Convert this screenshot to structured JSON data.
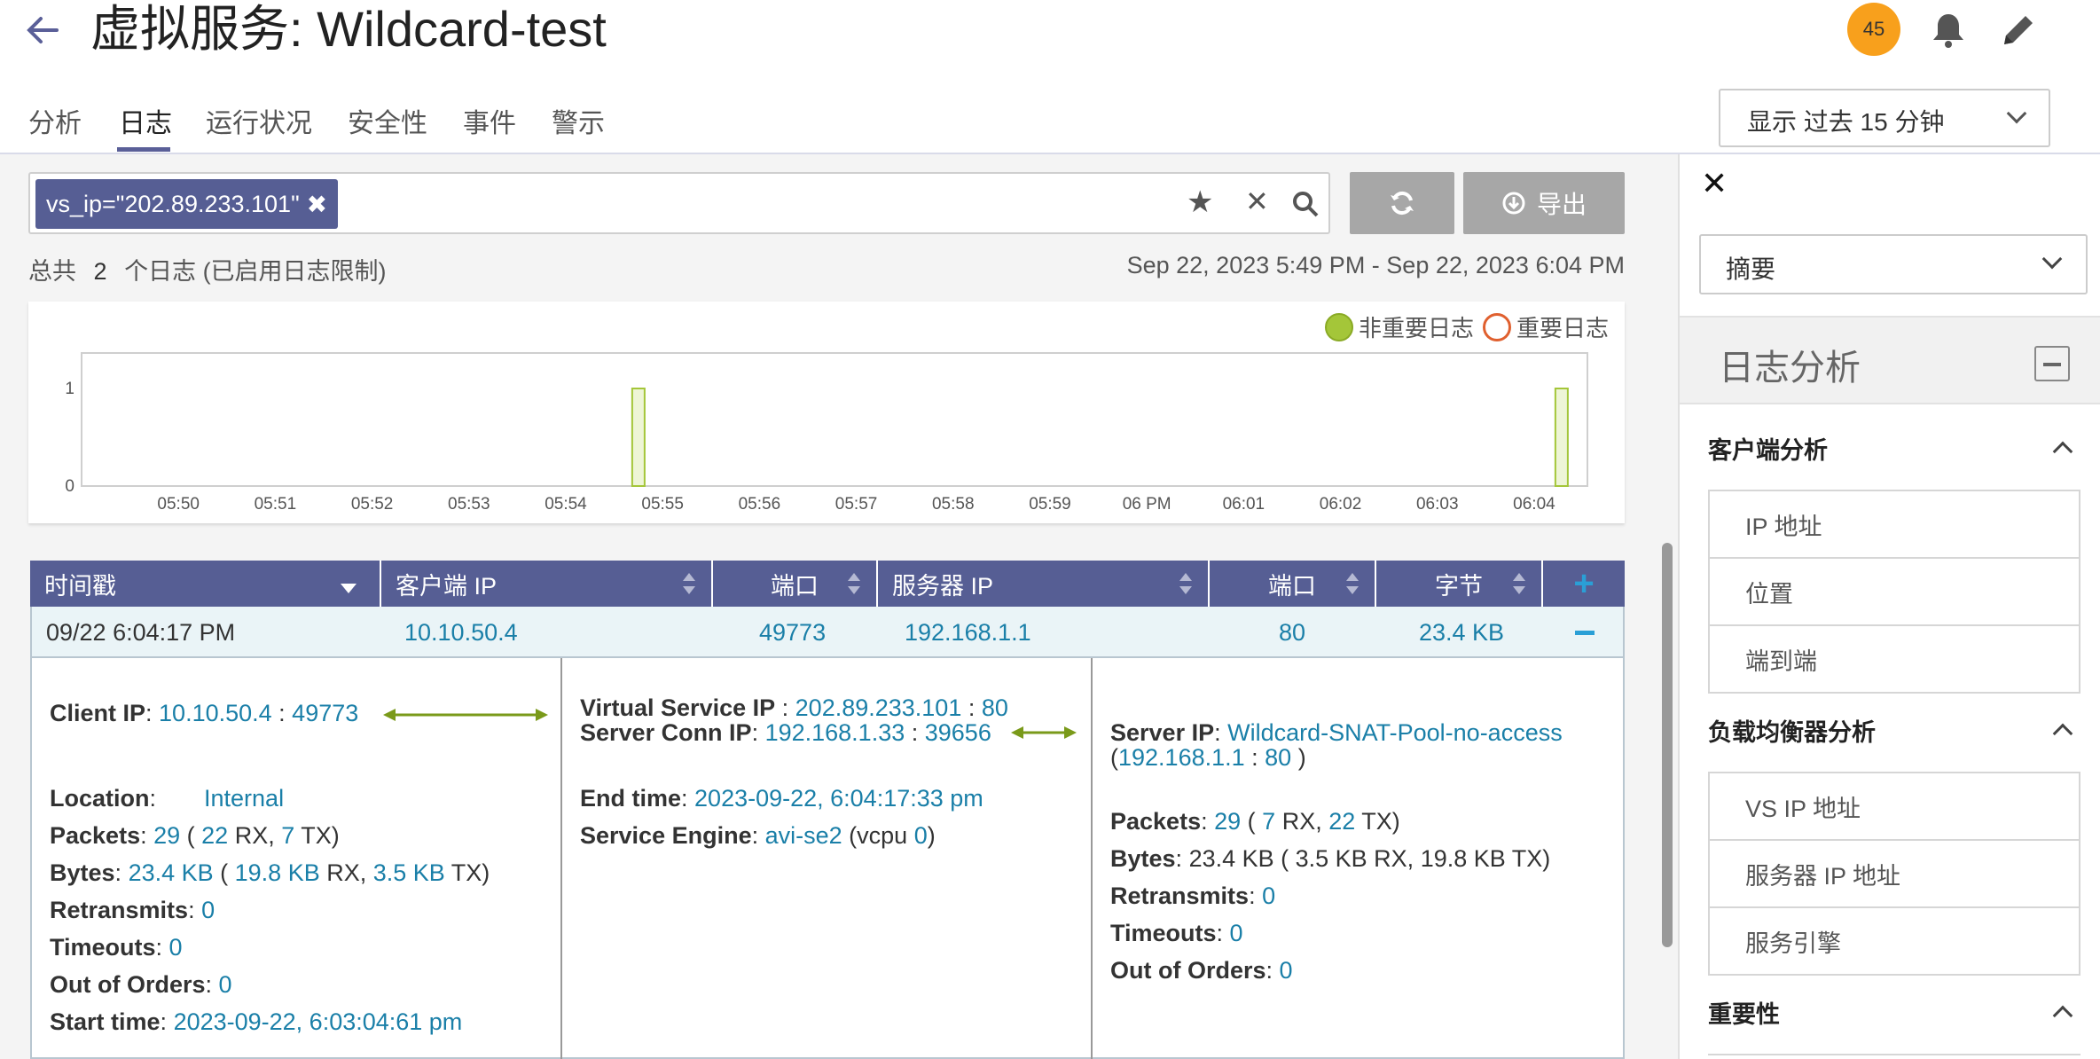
{
  "header": {
    "title": "虚拟服务: Wildcard-test",
    "badge_count": "45"
  },
  "tabs": [
    "分析",
    "日志",
    "运行状况",
    "安全性",
    "事件",
    "警示"
  ],
  "active_tab": "日志",
  "time_range": "显示 过去 15 分钟",
  "search": {
    "chip": "vs_ip=\"202.89.233.101\"",
    "export_label": "导出"
  },
  "summary": {
    "prefix": "总共",
    "count": "2",
    "suffix": "个日志 (已启用日志限制)",
    "range": "Sep 22, 2023 5:49 PM - Sep 22, 2023 6:04 PM"
  },
  "chart_data": {
    "type": "bar",
    "legend": [
      "非重要日志",
      "重要日志"
    ],
    "legend_colors": [
      "#a4c639",
      "#e0602f"
    ],
    "legend_position": "top-right",
    "x_ticks": [
      "05:50",
      "05:51",
      "05:52",
      "05:53",
      "05:54",
      "05:55",
      "05:56",
      "05:57",
      "05:58",
      "05:59",
      "06 PM",
      "06:01",
      "06:02",
      "06:03",
      "06:04"
    ],
    "y_ticks": [
      "0",
      "1"
    ],
    "ylim": [
      0,
      1
    ],
    "series": [
      {
        "name": "非重要日志",
        "points": [
          {
            "x": "05:54:45",
            "y": 1
          },
          {
            "x": "06:04:17",
            "y": 1
          }
        ]
      }
    ]
  },
  "table": {
    "headers": [
      "时间戳",
      "客户端 IP",
      "端口",
      "服务器 IP",
      "端口",
      "字节"
    ],
    "row": {
      "time": "09/22 6:04:17 PM",
      "client_ip": "10.10.50.4",
      "client_port": "49773",
      "server_ip": "192.168.1.1",
      "server_port": "80",
      "bytes": "23.4 KB"
    }
  },
  "detail": {
    "client": {
      "client_ip_label": "Client IP",
      "client_ip": "10.10.50.4",
      "client_port": "49773",
      "location_label": "Location",
      "location": "Internal",
      "packets_label": "Packets",
      "packets": "29",
      "packets_rx": "22",
      "packets_tx": "7",
      "bytes_label": "Bytes",
      "bytes": "23.4 KB",
      "bytes_rx": "19.8 KB",
      "bytes_tx": "3.5 KB",
      "retransmits_label": "Retransmits",
      "retransmits": "0",
      "timeouts_label": "Timeouts",
      "timeouts": "0",
      "ooo_label": "Out of Orders",
      "ooo": "0",
      "start_label": "Start time",
      "start": "2023-09-22, 6:03:04:61 pm"
    },
    "vs": {
      "vs_ip_label": "Virtual Service IP",
      "vs_ip": "202.89.233.101",
      "vs_port": "80",
      "conn_label": "Server Conn IP",
      "conn_ip": "192.168.1.33",
      "conn_port": "39656",
      "end_label": "End time",
      "end": "2023-09-22, 6:04:17:33 pm",
      "se_label": "Service Engine",
      "se": "avi-se2",
      "vcpu": "0"
    },
    "server": {
      "server_ip_label": "Server IP",
      "pool": "Wildcard-SNAT-Pool-no-access",
      "ip": "192.168.1.1",
      "port": "80",
      "packets_label": "Packets",
      "packets": "29",
      "packets_rx": "7",
      "packets_tx": "22",
      "bytes_label": "Bytes",
      "bytes_text": "23.4 KB ( 3.5 KB RX, 19.8 KB TX)",
      "retransmits_label": "Retransmits",
      "retransmits": "0",
      "timeouts_label": "Timeouts",
      "timeouts": "0",
      "ooo_label": "Out of Orders",
      "ooo": "0"
    }
  },
  "sidebar": {
    "select": "摘要",
    "panel_title": "日志分析",
    "sections": [
      {
        "title": "客户端分析",
        "items": [
          "IP 地址",
          "位置",
          "端到端"
        ]
      },
      {
        "title": "负载均衡器分析",
        "items": [
          "VS IP 地址",
          "服务器 IP 地址",
          "服务引擎"
        ]
      },
      {
        "title": "重要性",
        "items": []
      }
    ]
  },
  "colors": {
    "accent": "#5a5f98",
    "header_bg": "#565e94",
    "link": "#1a7fa8",
    "badge": "#f8a01c",
    "bar": "#a4c639"
  }
}
